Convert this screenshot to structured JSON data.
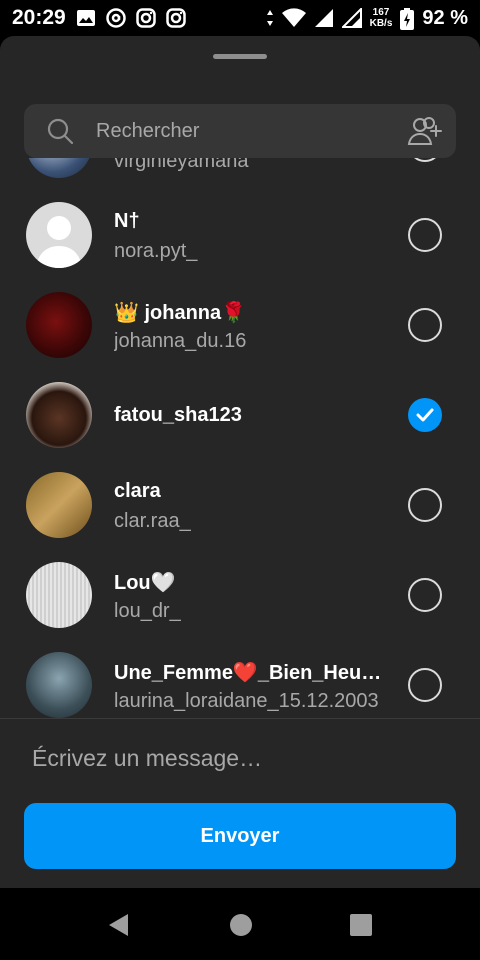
{
  "status_bar": {
    "time": "20:29",
    "speed_value": "167",
    "speed_unit": "KB/s",
    "battery": "92 %",
    "left_icons": [
      "image-icon",
      "at-sign-icon",
      "instagram-icon",
      "instagram-icon"
    ],
    "right_icons": [
      "data-arrows-icon",
      "wifi-icon",
      "signal-icon",
      "signal-icon",
      "battery-icon"
    ]
  },
  "search": {
    "placeholder": "Rechercher"
  },
  "contacts": [
    {
      "name": "",
      "username": "virginieyamana",
      "selected": false,
      "partial": true
    },
    {
      "name": "N†",
      "username": "nora.pyt_",
      "selected": false
    },
    {
      "name": "👑 johanna🌹",
      "username": "johanna_du.16",
      "selected": false
    },
    {
      "name": "fatou_sha123",
      "username": "",
      "selected": true
    },
    {
      "name": "clara",
      "username": "clar.raa_",
      "selected": false
    },
    {
      "name": "Lou🤍",
      "username": "lou_dr_",
      "selected": false
    },
    {
      "name": "Une_Femme❤️_Bien_Heureuse",
      "username": "laurina_loraidane_15.12.2003",
      "selected": false
    }
  ],
  "composer": {
    "placeholder": "Écrivez un message…"
  },
  "send_button": {
    "label": "Envoyer"
  },
  "colors": {
    "sheet": "#262626",
    "accent": "#0095f6",
    "search_bg": "#363636",
    "secondary_text": "#a8a8a8"
  }
}
